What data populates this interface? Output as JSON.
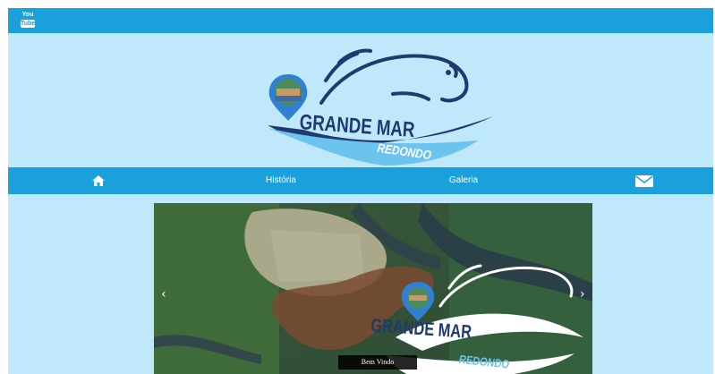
{
  "topbar": {
    "youtube_icon": "youtube-icon",
    "youtube_text_top": "You",
    "youtube_text_bottom": "Tube"
  },
  "logo": {
    "line1": "GRANDE MAR",
    "line2": "REDONDO"
  },
  "nav": {
    "home_icon": "home-icon",
    "items": [
      {
        "label": "História"
      },
      {
        "label": "Galeria"
      }
    ],
    "mail_icon": "envelope-icon"
  },
  "carousel": {
    "caption": "Bem Vindo",
    "prev_label": "‹",
    "next_label": "›",
    "logo_line1": "GRANDE MAR",
    "logo_line2": "REDONDO"
  },
  "colors": {
    "bar_blue": "#1aa1dc",
    "page_bg": "#bfe9fb",
    "logo_navy": "#1f3a6e",
    "logo_light_blue": "#6cc3ee"
  }
}
